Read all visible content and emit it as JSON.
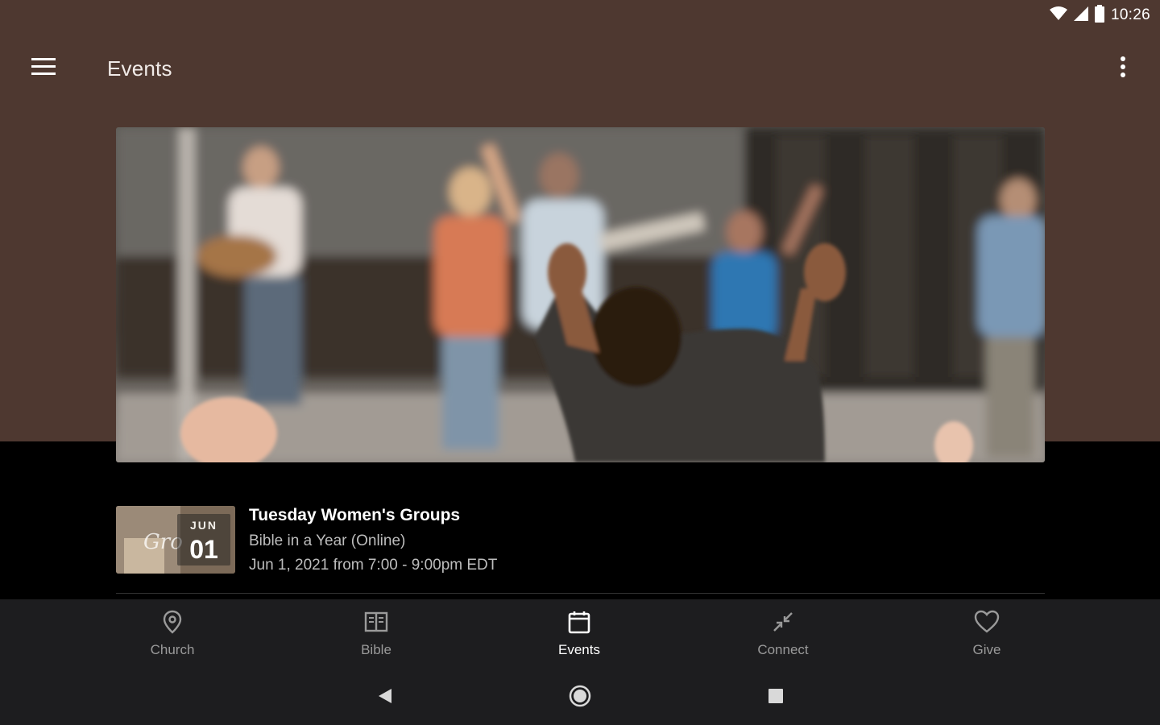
{
  "status_bar": {
    "time": "10:26"
  },
  "app_bar": {
    "title": "Events"
  },
  "hero": {
    "image_alt": "worship"
  },
  "event": {
    "title": "Tuesday Women's Groups",
    "subtitle": "Bible in a Year (Online)",
    "datetime": "Jun 1, 2021 from 7:00 - 9:00pm EDT",
    "thumb_month": "JUN",
    "thumb_day": "01",
    "thumb_script": "Gro"
  },
  "bottom_nav": {
    "items": [
      {
        "label": "Church",
        "icon": "map-pin-icon"
      },
      {
        "label": "Bible",
        "icon": "book-icon"
      },
      {
        "label": "Events",
        "icon": "calendar-icon",
        "active": true
      },
      {
        "label": "Connect",
        "icon": "connect-arrows-icon"
      },
      {
        "label": "Give",
        "icon": "heart-icon"
      }
    ]
  },
  "colors": {
    "header_bg": "#4e3830",
    "body_bg": "#000000",
    "nav_bg": "#1d1d1f",
    "active": "#ffffff",
    "inactive": "#9a9a9a"
  }
}
